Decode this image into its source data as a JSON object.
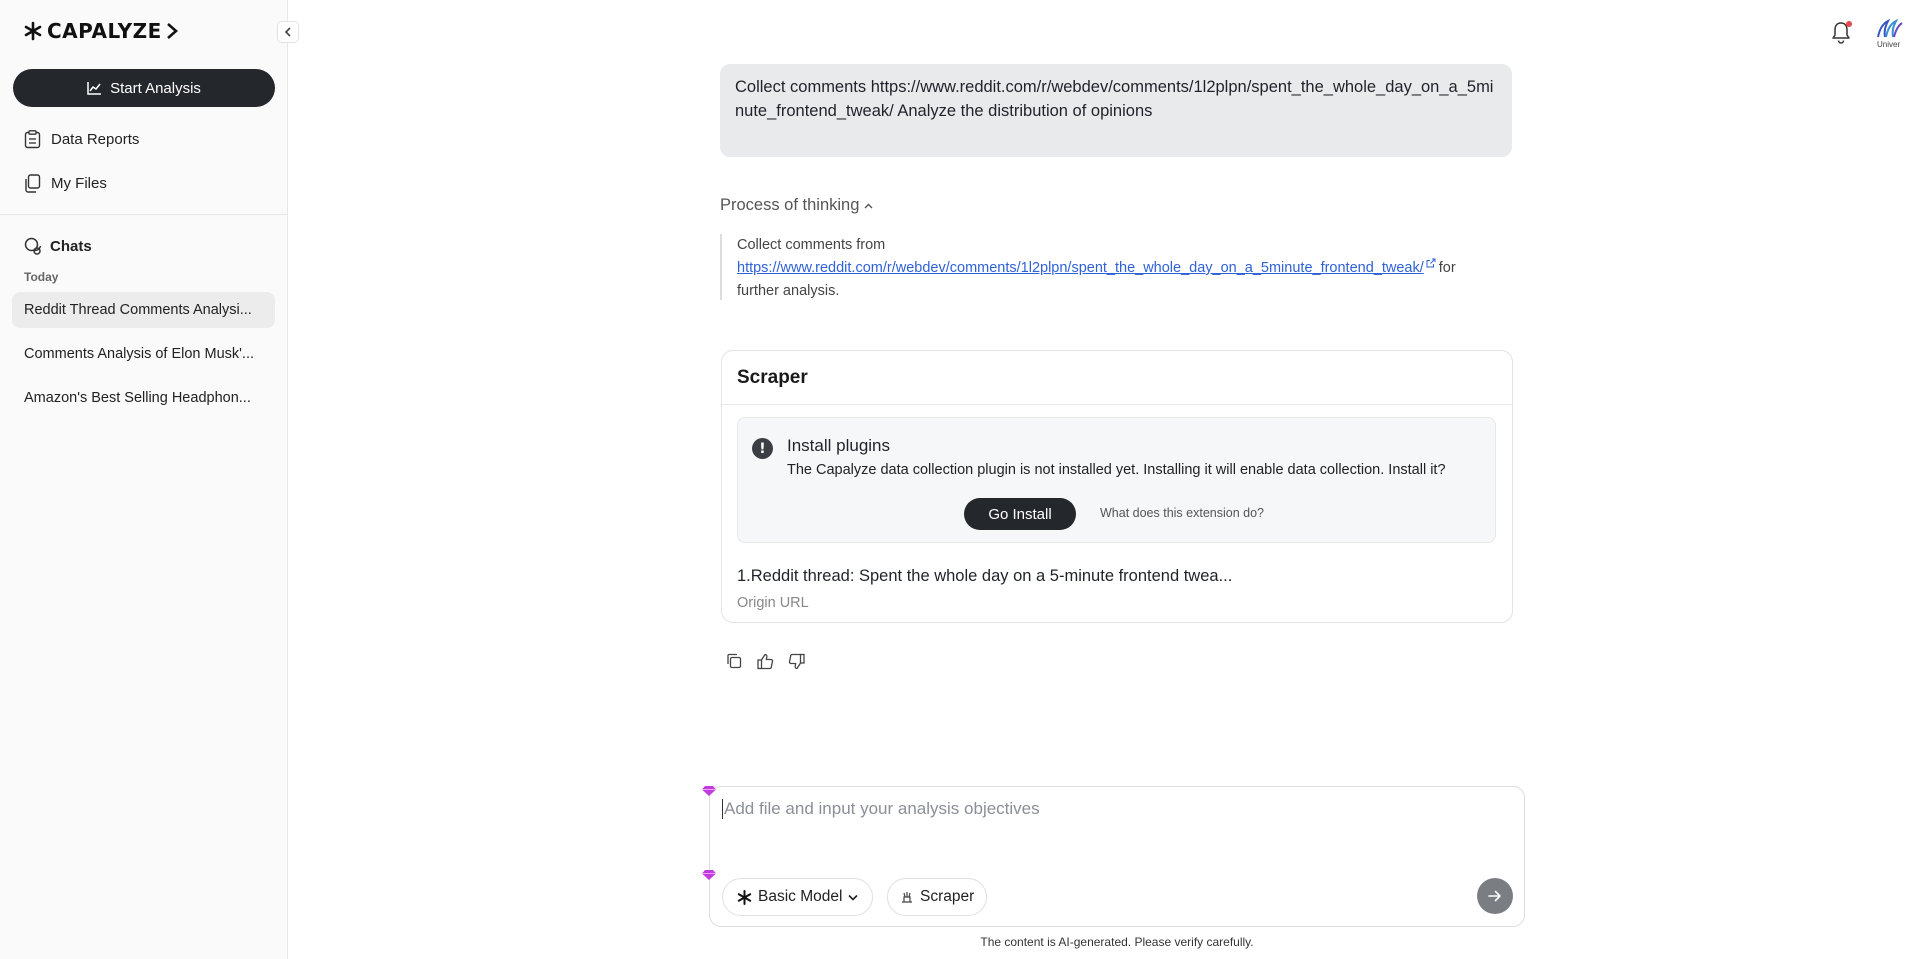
{
  "sidebar": {
    "logo_text": "CAPALYZE",
    "start_label": "Start Analysis",
    "nav": [
      {
        "label": "Data Reports",
        "icon": "report-icon"
      },
      {
        "label": "My Files",
        "icon": "files-icon"
      }
    ],
    "chats_label": "Chats",
    "today_label": "Today",
    "chats": [
      {
        "title": "Reddit Thread Comments Analysi...",
        "active": true
      },
      {
        "title": "Comments Analysis of Elon Musk'...",
        "active": false
      },
      {
        "title": "Amazon's Best Selling Headphon...",
        "active": false
      }
    ]
  },
  "header": {
    "avatar_label": "Univer"
  },
  "conversation": {
    "user_message": "Collect comments https://www.reddit.com/r/webdev/comments/1l2plpn/spent_the_whole_day_on_a_5minute_frontend_tweak/ Analyze the distribution of opinions",
    "thinking_label": "Process of thinking",
    "thinking_prefix": "Collect comments from",
    "thinking_link": "https://www.reddit.com/r/webdev/comments/1l2plpn/spent_the_whole_day_on_a_5minute_frontend_tweak/",
    "thinking_suffix": "for",
    "thinking_suffix2": "further analysis.",
    "scraper": {
      "title": "Scraper",
      "plugin_title": "Install plugins",
      "plugin_desc": "The Capalyze data collection plugin is not installed yet. Installing it will enable data collection. Install it?",
      "install_label": "Go Install",
      "what_label": "What does this extension do?",
      "result_title": "1.Reddit thread: Spent the whole day on a 5-minute frontend twea...",
      "origin_label": "Origin URL"
    }
  },
  "input": {
    "placeholder": "Add file and input your analysis objectives",
    "value": "",
    "model_label": "Basic Model",
    "scraper_label": "Scraper",
    "disclaimer": "The content is AI-generated. Please verify carefully."
  },
  "colors": {
    "primary_dark": "#24272c",
    "link": "#2f62d6",
    "accent_purple": "#c23ae0",
    "notification_dot": "#e5484d"
  }
}
